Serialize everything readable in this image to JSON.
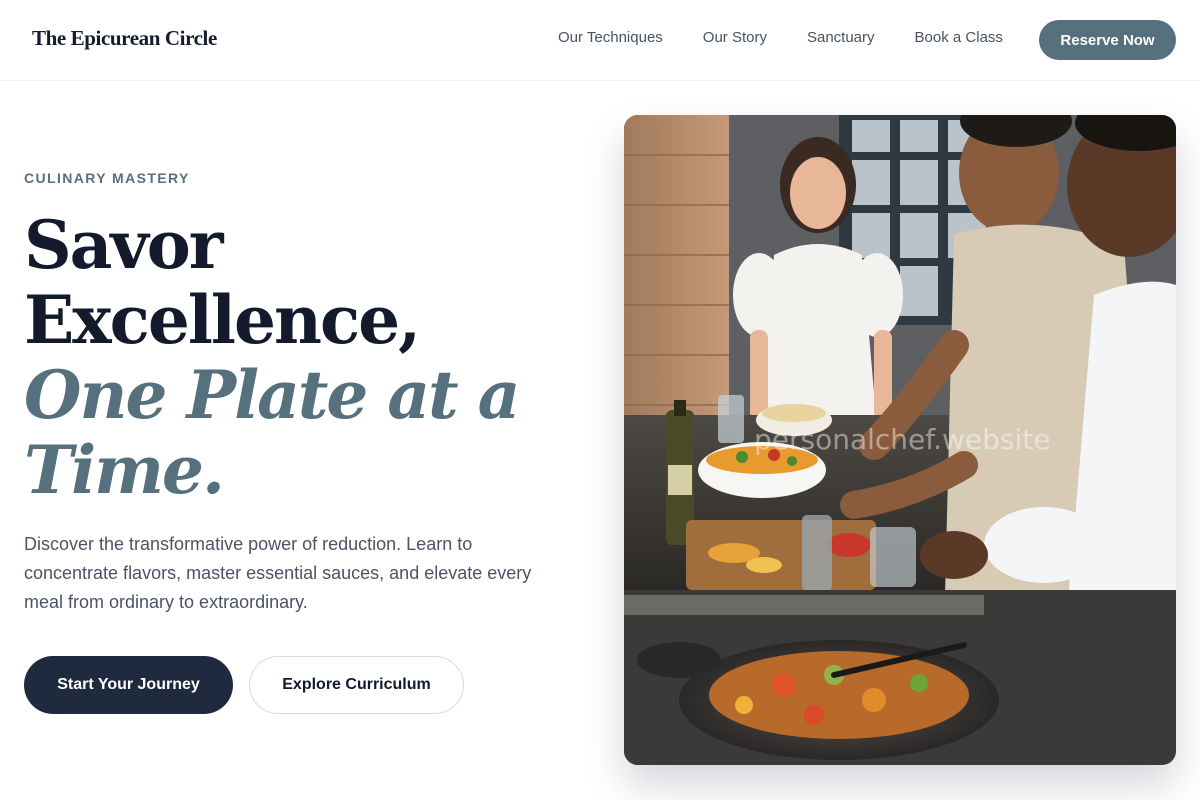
{
  "brand": {
    "name": "The Epicurean Circle"
  },
  "nav": {
    "items": [
      {
        "label": "Our Techniques"
      },
      {
        "label": "Our Story"
      },
      {
        "label": "Sanctuary"
      },
      {
        "label": "Book a Class"
      }
    ],
    "cta_label": "Reserve Now"
  },
  "hero": {
    "eyebrow": "CULINARY MASTERY",
    "headline_line1": "Savor",
    "headline_line2": "Excellence,",
    "headline_accent_line1": "One Plate at a",
    "headline_accent_line2": "Time.",
    "description": "Discover the transformative power of reduction. Learn to concentrate flavors, master essential sauces, and elevate every meal from ordinary to extraordinary.",
    "primary_cta": "Start Your Journey",
    "secondary_cta": "Explore Curriculum",
    "image_watermark": "personalchef.website"
  },
  "colors": {
    "accent": "#56707e",
    "dark": "#1f2a3e",
    "headline": "#121a2c"
  }
}
